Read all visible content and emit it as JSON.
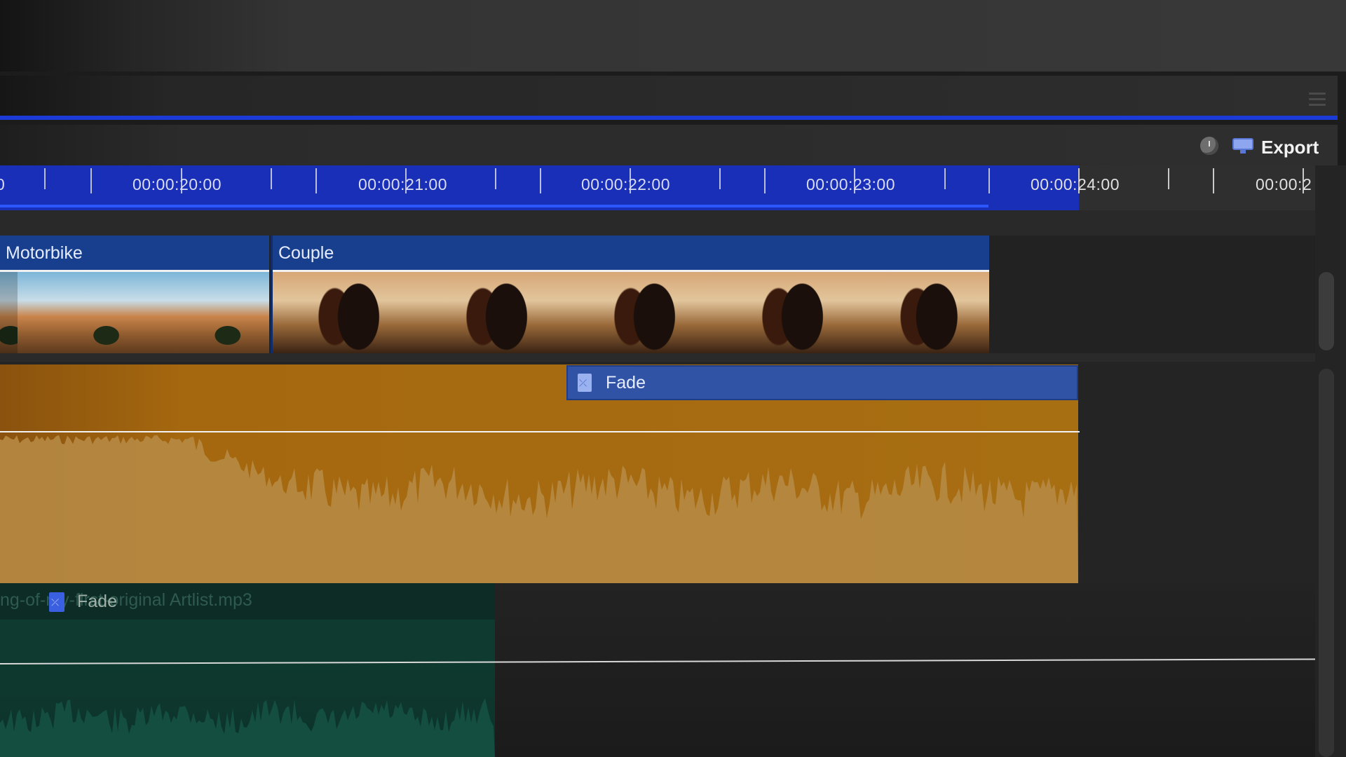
{
  "toolbar": {
    "history_icon": "history-icon",
    "export_icon": "monitor-export-icon",
    "export_label": "Export"
  },
  "ruler": {
    "labels": [
      "00:00:20:00",
      "00:00:21:00",
      "00:00:22:00",
      "00:00:23:00",
      "00:00:24:00",
      "00:00:2"
    ],
    "left_edge_fragment": "0"
  },
  "video_track": {
    "clips": [
      {
        "name": "Motorbike"
      },
      {
        "name": "Couple"
      }
    ]
  },
  "audio_track_1": {
    "transition_label": "Fade",
    "transition_icon": "fade-transition-icon",
    "color": "#a86e12"
  },
  "audio_track_2": {
    "clip_name": "ng-of-my-first-original Artlist.mp3",
    "transition_label": "Fade",
    "transition_icon": "fade-transition-icon",
    "color": "#0f3a30"
  },
  "colors": {
    "accent_blue": "#1b3bd8",
    "clip_header": "#173f8d",
    "transition": "#3053a6"
  }
}
